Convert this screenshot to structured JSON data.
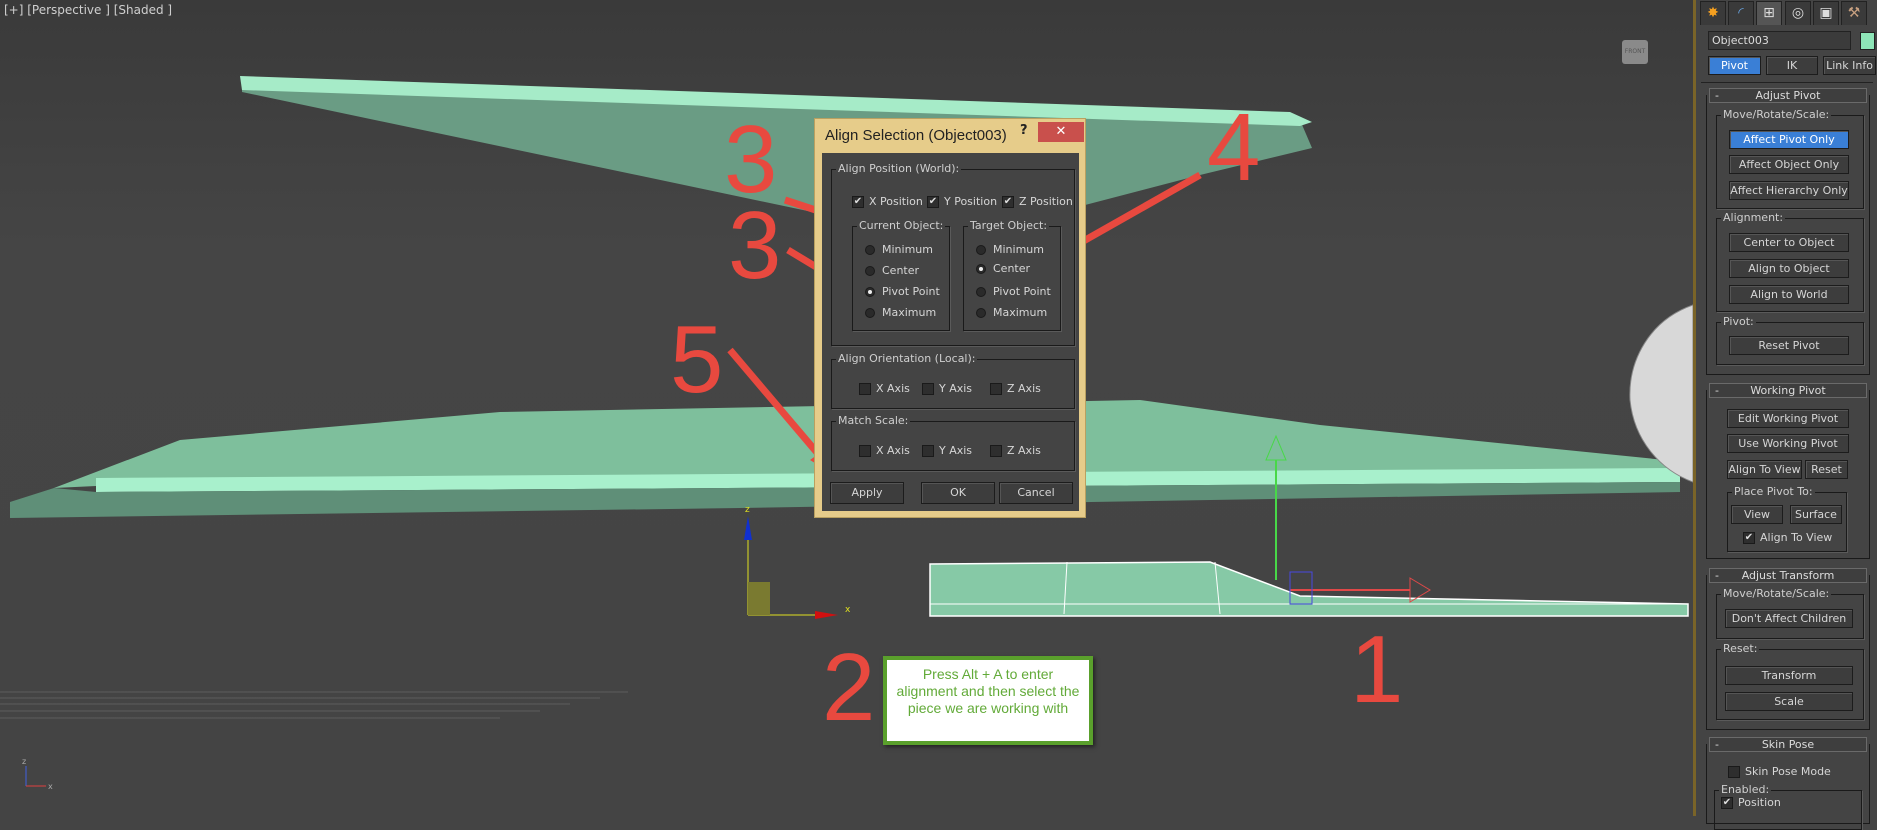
{
  "viewport": {
    "label": "[+] [Perspective ] [Shaded ]",
    "viewcube": "FRONT",
    "gizmo_axes": {
      "z": "z",
      "x": "x"
    },
    "corner_axes": {
      "z": "z",
      "x": "x"
    }
  },
  "annotations": {
    "numbers": [
      "3",
      "3",
      "4",
      "5",
      "2",
      "1"
    ],
    "note": "Press Alt + A to enter alignment and then select the piece we are working with",
    "arrow_color": "#e8493f",
    "note_border": "#5aa02c"
  },
  "dialog": {
    "title": "Align Selection (Object003)",
    "help": "?",
    "close": "✕",
    "align_position": {
      "label": "Align Position (World):",
      "checks": [
        {
          "label": "X Position",
          "checked": true
        },
        {
          "label": "Y Position",
          "checked": true
        },
        {
          "label": "Z Position",
          "checked": true
        }
      ],
      "current": {
        "label": "Current Object:",
        "options": [
          "Minimum",
          "Center",
          "Pivot Point",
          "Maximum"
        ],
        "selected": "Pivot Point"
      },
      "target": {
        "label": "Target Object:",
        "options": [
          "Minimum",
          "Center",
          "Pivot Point",
          "Maximum"
        ],
        "selected": "Center"
      }
    },
    "align_orientation": {
      "label": "Align Orientation (Local):",
      "checks": [
        "X Axis",
        "Y Axis",
        "Z Axis"
      ]
    },
    "match_scale": {
      "label": "Match Scale:",
      "checks": [
        "X Axis",
        "Y Axis",
        "Z Axis"
      ]
    },
    "buttons": {
      "apply": "Apply",
      "ok": "OK",
      "cancel": "Cancel"
    }
  },
  "panel": {
    "tabs": [
      "create-icon",
      "modify-icon",
      "hierarchy-icon",
      "motion-icon",
      "display-icon",
      "utilities-icon"
    ],
    "object_name": "Object003",
    "object_color": "#8ee6b8",
    "subtabs": [
      "Pivot",
      "IK",
      "Link Info"
    ],
    "adjust_pivot": {
      "title": "Adjust Pivot",
      "collapse": "-",
      "mrs": "Move/Rotate/Scale:",
      "mrs_buttons": [
        "Affect Pivot Only",
        "Affect Object Only",
        "Affect Hierarchy Only"
      ],
      "alignment": "Alignment:",
      "alignment_buttons": [
        "Center to Object",
        "Align to Object",
        "Align to World"
      ],
      "pivot": "Pivot:",
      "reset_pivot": "Reset Pivot"
    },
    "working_pivot": {
      "title": "Working Pivot",
      "collapse": "-",
      "edit": "Edit Working Pivot",
      "use": "Use Working Pivot",
      "align_to_view": "Align To View",
      "reset": "Reset",
      "place": "Place Pivot To:",
      "view": "View",
      "surface": "Surface",
      "align_check": "Align To View"
    },
    "adjust_transform": {
      "title": "Adjust Transform",
      "collapse": "-",
      "mrs": "Move/Rotate/Scale:",
      "dont_affect": "Don't Affect Children",
      "reset": "Reset:",
      "transform": "Transform",
      "scale": "Scale"
    },
    "skin_pose": {
      "title": "Skin Pose",
      "collapse": "-",
      "mode": "Skin Pose Mode",
      "enabled": "Enabled:",
      "position": "Position"
    }
  }
}
